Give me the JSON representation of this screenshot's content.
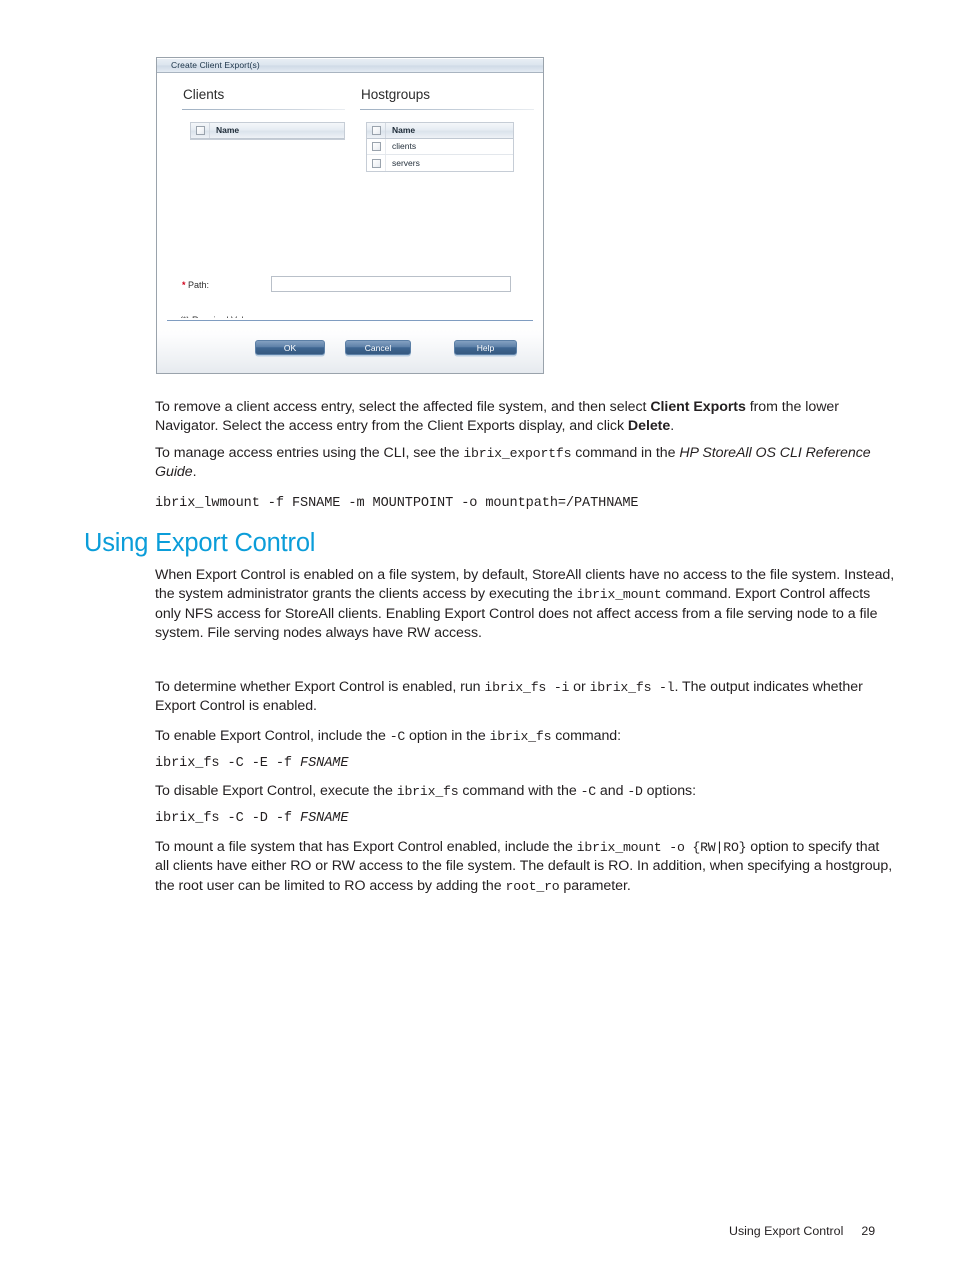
{
  "dialog": {
    "title": "Create Client Export(s)",
    "columns": [
      {
        "heading": "Clients"
      },
      {
        "heading": "Hostgroups"
      }
    ],
    "clients_grid": {
      "header": "Name",
      "rows": []
    },
    "hostgroups_grid": {
      "header": "Name",
      "rows": [
        "clients",
        "servers"
      ]
    },
    "path": {
      "required_marker": "*",
      "label": "Path:",
      "value": ""
    },
    "required_note": "(*) Required Value",
    "buttons": {
      "ok": "OK",
      "cancel": "Cancel",
      "help": "Help"
    }
  },
  "content": {
    "p1_a": "To remove a client access entry, select the affected file system, and then select ",
    "p1_b": "Client Exports",
    "p1_c": " from the lower Navigator. Select the access entry from the Client Exports display, and click ",
    "p1_d": "Delete",
    "p1_e": ".",
    "p2_a": "To manage access entries using the CLI, see the ",
    "p2_b": "ibrix_exportfs",
    "p2_c": " command in the ",
    "p2_d": "HP StoreAll OS CLI Reference Guide",
    "p2_e": ".",
    "code1": "ibrix_lwmount -f FSNAME -m MOUNTPOINT -o mountpath=/PATHNAME",
    "heading": "Using Export Control",
    "p3_a": "When Export Control is enabled on a file system, by default, StoreAll clients have no access to the file system. Instead, the system administrator grants the clients access by executing the ",
    "p3_b": "ibrix_mount",
    "p3_c": " command. Export Control affects only NFS access for StoreAll clients. Enabling Export Control does not affect access from a file serving node to a file system. File serving nodes always have RW access.",
    "p4_a": "To determine whether Export Control is enabled, run ",
    "p4_b": "ibrix_fs -i",
    "p4_c": " or ",
    "p4_d": "ibrix_fs -l",
    "p4_e": ". The output indicates whether Export Control is enabled.",
    "p5_a": "To enable Export Control, include the ",
    "p5_b": "-C",
    "p5_c": " option in the ",
    "p5_d": "ibrix_fs",
    "p5_e": " command:",
    "code2_pre": "ibrix_fs -C -E -f ",
    "code2_italic": "FSNAME",
    "p6_a": "To disable Export Control, execute the ",
    "p6_b": "ibrix_fs",
    "p6_c": " command with the ",
    "p6_d": "-C",
    "p6_e": " and ",
    "p6_f": "-D",
    "p6_g": " options:",
    "code3_pre": "ibrix_fs -C -D -f ",
    "code3_italic": "FSNAME",
    "p7_a": "To mount a file system that has Export Control enabled, include the ",
    "p7_b": "ibrix_mount -o {RW|RO}",
    "p7_c": " option to specify that all clients have either RO or RW access to the file system. The default is RO. In addition, when specifying a hostgroup, the root user can be limited to RO access by adding the ",
    "p7_d": "root_ro",
    "p7_e": " parameter."
  },
  "page_footer": {
    "section": "Using Export Control",
    "page_number": "29"
  }
}
